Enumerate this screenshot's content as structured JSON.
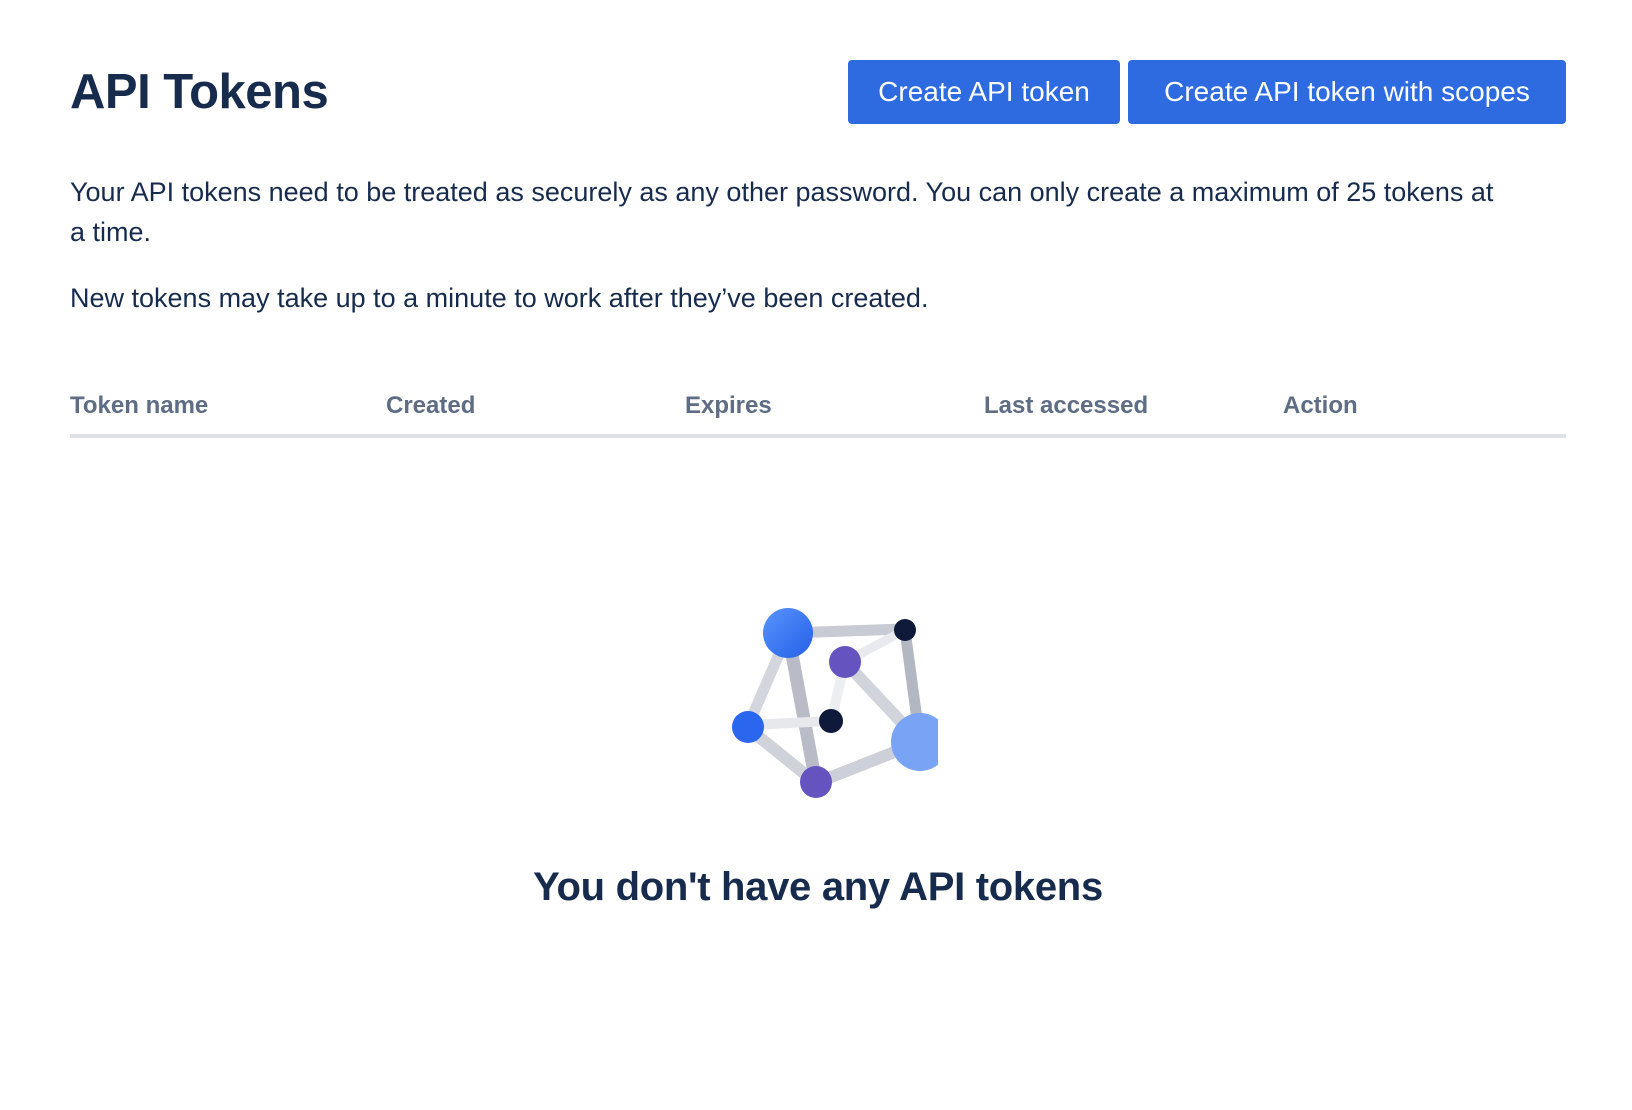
{
  "header": {
    "title": "API Tokens",
    "create_button_label": "Create API token",
    "create_scoped_button_label": "Create API token with scopes"
  },
  "description": {
    "paragraph1": "Your API tokens need to be treated as securely as any other password. You can only create a maximum of 25 tokens at a time.",
    "paragraph2": "New tokens may take up to a minute to work after they’ve been created."
  },
  "table": {
    "columns": [
      "Token name",
      "Created",
      "Expires",
      "Last accessed",
      "Action"
    ]
  },
  "empty_state": {
    "illustration_icon": "network-nodes-illustration",
    "message": "You don't have any API tokens"
  },
  "colors": {
    "primary_button": "#2e6be0",
    "heading_text": "#172b4d",
    "column_header_text": "#5e6c84",
    "table_divider": "#dfe1e6",
    "node_blue": "#3d7bf5",
    "node_light_blue": "#79a3f5",
    "node_purple": "#6554c0",
    "node_dark": "#0f1a3a"
  }
}
